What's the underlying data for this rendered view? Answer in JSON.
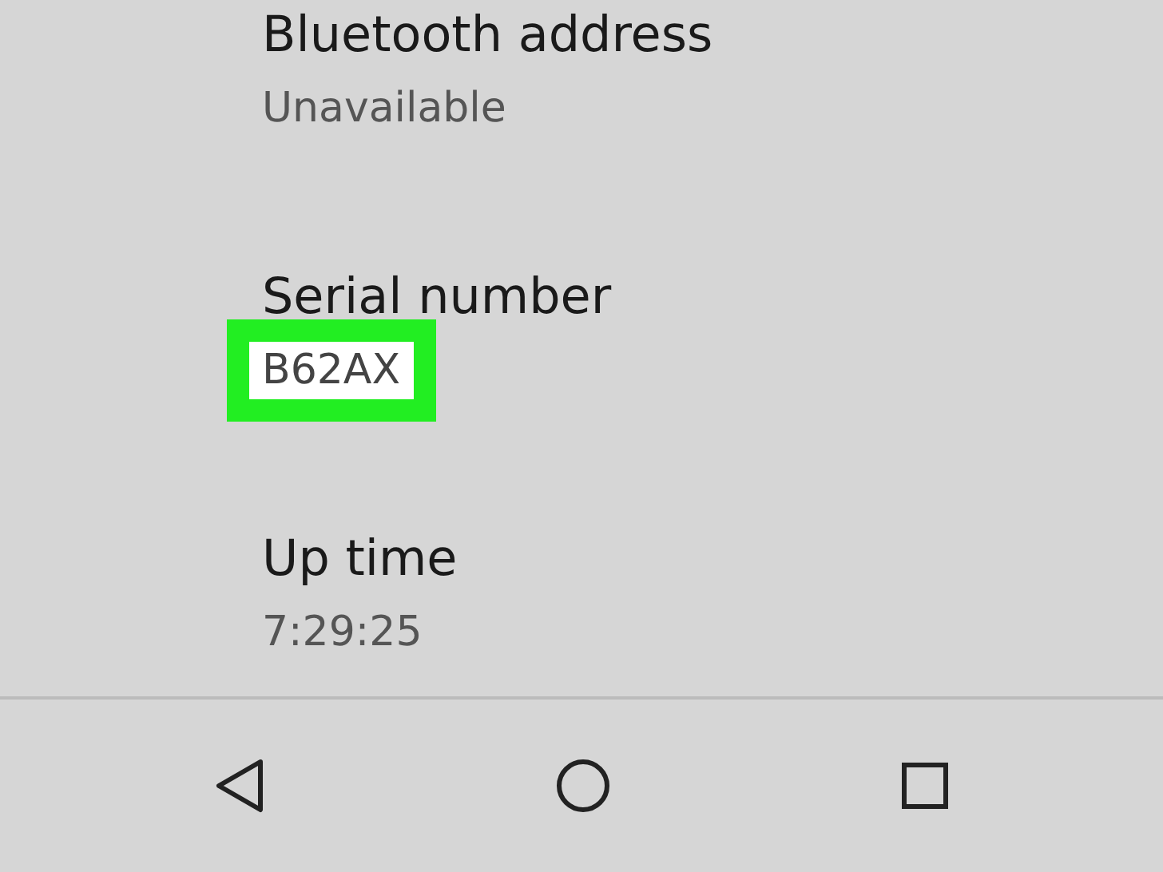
{
  "details": [
    {
      "title": "Bluetooth address",
      "value": "Unavailable",
      "highlighted": false
    },
    {
      "title": "Serial number",
      "value": "B62AX",
      "highlighted": true
    },
    {
      "title": "Up time",
      "value": "7:29:25",
      "highlighted": false
    }
  ]
}
